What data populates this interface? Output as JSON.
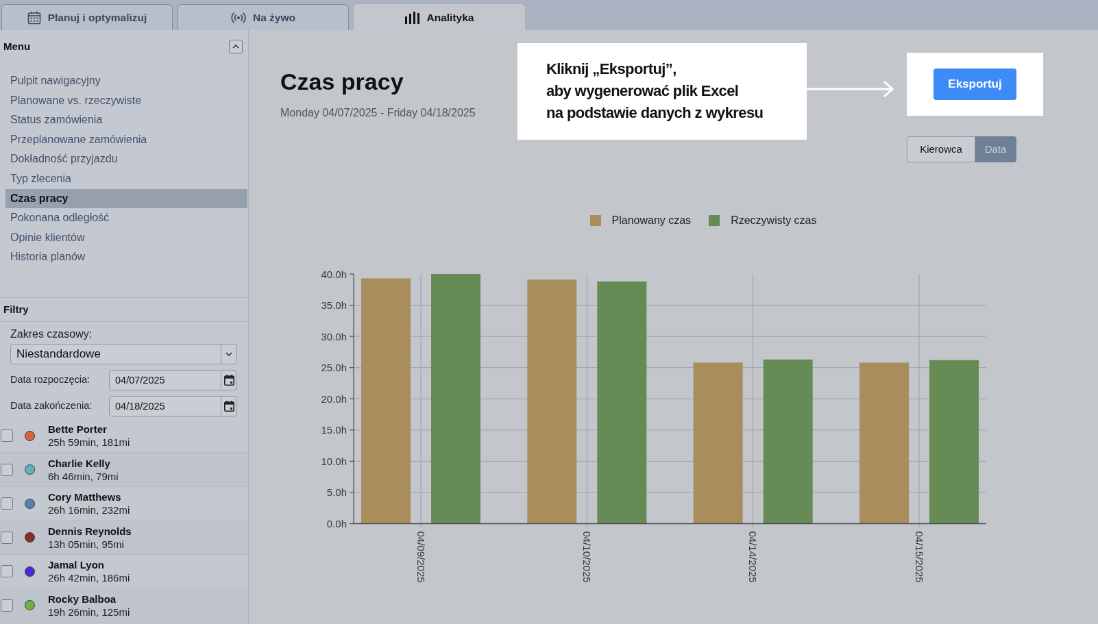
{
  "tabs": [
    {
      "label": "Planuj i optymalizuj",
      "selected": false
    },
    {
      "label": "Na żywo",
      "selected": false
    },
    {
      "label": "Analityka",
      "selected": true
    }
  ],
  "sidebar": {
    "menu": {
      "title": "Menu",
      "expanded": true,
      "items": [
        {
          "label": "Pulpit nawigacyjny",
          "selected": false
        },
        {
          "label": "Planowane vs. rzeczywiste",
          "selected": false
        },
        {
          "label": "Status zamówienia",
          "selected": false
        },
        {
          "label": "Przeplanowane zamówienia",
          "selected": false
        },
        {
          "label": "Dokładność przyjazdu",
          "selected": false
        },
        {
          "label": "Typ zlecenia",
          "selected": false
        },
        {
          "label": "Czas pracy",
          "selected": true
        },
        {
          "label": "Pokonana odległość",
          "selected": false
        },
        {
          "label": "Opinie klientów",
          "selected": false
        },
        {
          "label": "Historia planów",
          "selected": false
        }
      ]
    },
    "filters": {
      "title": "Filtry",
      "time_range": {
        "label": "Zakres czasowy:",
        "value": "Niestandardowe"
      },
      "start_date": {
        "label": "Data rozpoczęcia:",
        "value": "04/07/2025"
      },
      "end_date": {
        "label": "Data zakończenia:",
        "value": "04/18/2025"
      }
    },
    "drivers": [
      {
        "name": "Bette Porter",
        "summary": "25h 59min, 181mi",
        "color": "#d8633f",
        "checked": false
      },
      {
        "name": "Charlie Kelly",
        "summary": "6h 46min, 79mi",
        "color": "#5bb3bd",
        "checked": false
      },
      {
        "name": "Cory Matthews",
        "summary": "26h 16min, 232mi",
        "color": "#5b7fb3",
        "checked": false
      },
      {
        "name": "Dennis Reynolds",
        "summary": "13h 05min, 95mi",
        "color": "#8a2a2a",
        "checked": false
      },
      {
        "name": "Jamal Lyon",
        "summary": "26h 42min, 186mi",
        "color": "#4b2ad6",
        "checked": false
      },
      {
        "name": "Rocky Balboa",
        "summary": "19h 26min, 125mi",
        "color": "#6eb246",
        "checked": false
      }
    ]
  },
  "main": {
    "title": "Czas pracy",
    "subtitle": "Monday 04/07/2025 - Friday 04/18/2025",
    "export_button": "Eksportuj",
    "view_toggle": [
      {
        "label": "Kierowca",
        "selected": false
      },
      {
        "label": "Data",
        "selected": true
      }
    ],
    "chart_data": {
      "type": "bar",
      "categories": [
        "04/09/2025",
        "04/10/2025",
        "04/14/2025",
        "04/15/2025"
      ],
      "series": [
        {
          "name": "Planowany czas",
          "color": "#a98d5c",
          "values": [
            39.3,
            39.1,
            25.8,
            25.8
          ]
        },
        {
          "name": "Rzeczywisty czas",
          "color": "#668b55",
          "values": [
            40.0,
            38.8,
            26.3,
            26.2
          ]
        }
      ],
      "ylim": [
        0,
        40
      ],
      "yticks": [
        {
          "value": 0,
          "label": "0.0h"
        },
        {
          "value": 5,
          "label": "5.0h"
        },
        {
          "value": 10,
          "label": "10.0h"
        },
        {
          "value": 15,
          "label": "15.0h"
        },
        {
          "value": 20,
          "label": "20.0h"
        },
        {
          "value": 25,
          "label": "25.0h"
        },
        {
          "value": 30,
          "label": "30.0h"
        },
        {
          "value": 35,
          "label": "35.0h"
        },
        {
          "value": 40,
          "label": "40.0h"
        }
      ],
      "grid": true,
      "legend": true
    }
  },
  "callout": {
    "text": "Kliknij „Eksportuj”,\naby wygenerować plik Excel\nna podstawie danych z wykresu"
  }
}
